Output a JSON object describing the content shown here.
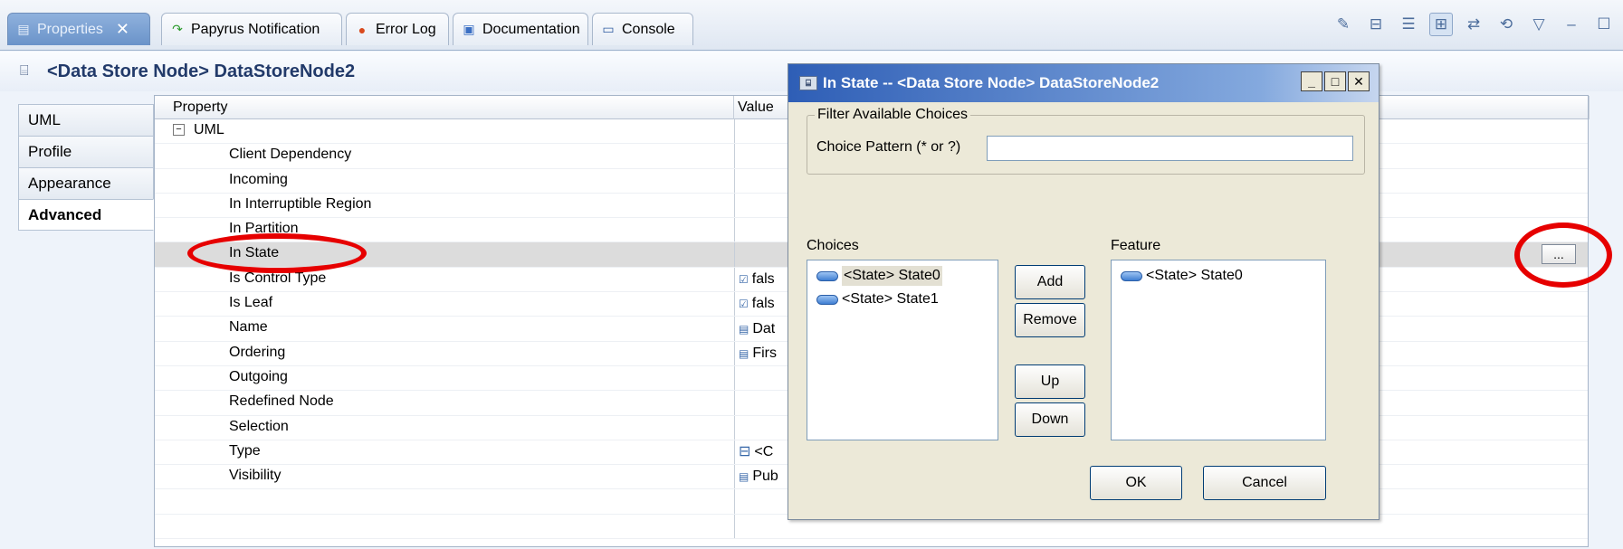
{
  "tabs": [
    {
      "label": "Properties",
      "icon": "properties-icon",
      "active": true
    },
    {
      "label": "Papyrus Notification",
      "icon": "papyrus-icon"
    },
    {
      "label": "Error Log",
      "icon": "error-log-icon"
    },
    {
      "label": "Documentation",
      "icon": "documentation-icon"
    },
    {
      "label": "Console",
      "icon": "console-icon"
    }
  ],
  "page_title": "<Data Store Node> DataStoreNode2",
  "categories": [
    "UML",
    "Profile",
    "Appearance",
    "Advanced"
  ],
  "active_category": "Advanced",
  "table": {
    "headers": {
      "property": "Property",
      "value": "Value"
    },
    "group": "UML",
    "rows": [
      {
        "property": "Client Dependency",
        "value": ""
      },
      {
        "property": "Incoming",
        "value": ""
      },
      {
        "property": "In Interruptible Region",
        "value": ""
      },
      {
        "property": "In Partition",
        "value": ""
      },
      {
        "property": "In State",
        "value": "",
        "selected": true
      },
      {
        "property": "Is Control Type",
        "value": "fals"
      },
      {
        "property": "Is Leaf",
        "value": "fals"
      },
      {
        "property": "Name",
        "value": "Dat"
      },
      {
        "property": "Ordering",
        "value": "Firs"
      },
      {
        "property": "Outgoing",
        "value": ""
      },
      {
        "property": "Redefined Node",
        "value": ""
      },
      {
        "property": "Selection",
        "value": ""
      },
      {
        "property": "Type",
        "value": "<C"
      },
      {
        "property": "Visibility",
        "value": "Pub"
      }
    ],
    "ellipsis_label": "..."
  },
  "dialog": {
    "title": "In State -- <Data Store Node> DataStoreNode2",
    "filter_legend": "Filter Available Choices",
    "pattern_label": "Choice Pattern (* or ?)",
    "pattern_value": "",
    "choices_label": "Choices",
    "feature_label": "Feature",
    "choices": [
      "<State> State0",
      "<State> State1"
    ],
    "features": [
      "<State> State0"
    ],
    "buttons": {
      "add": "Add",
      "remove": "Remove",
      "up": "Up",
      "down": "Down",
      "ok": "OK",
      "cancel": "Cancel"
    },
    "window_buttons": {
      "minimize": "_",
      "maximize": "□",
      "close": "✕"
    }
  },
  "highlight_color": "#e60000"
}
